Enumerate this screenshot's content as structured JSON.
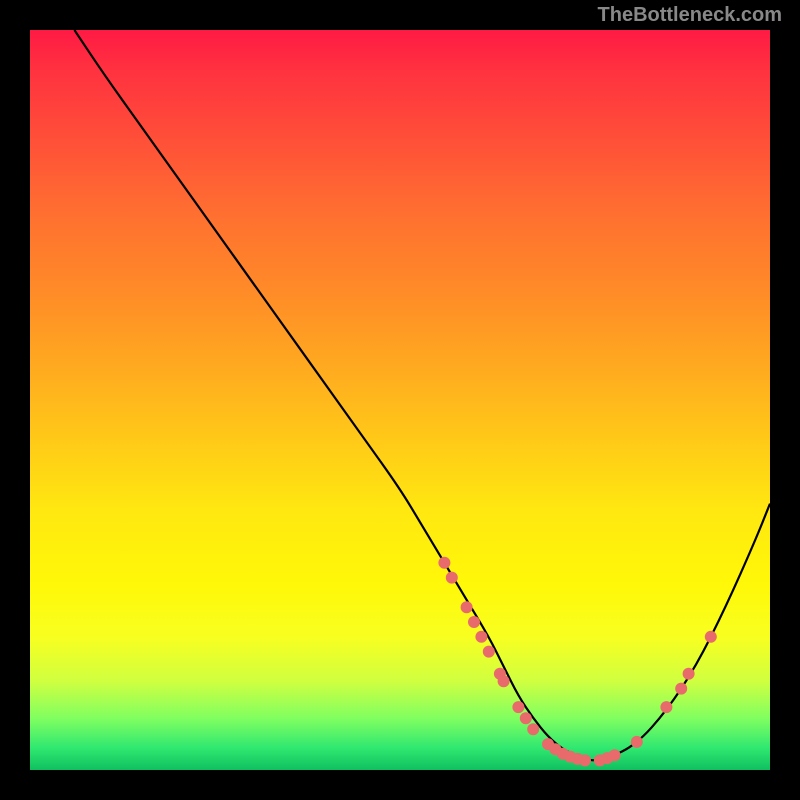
{
  "watermark": "TheBottleneck.com",
  "chart_data": {
    "type": "line",
    "title": "",
    "xlabel": "",
    "ylabel": "",
    "xlim": [
      0,
      100
    ],
    "ylim": [
      0,
      100
    ],
    "series": [
      {
        "name": "curve",
        "x": [
          6,
          10,
          15,
          20,
          25,
          30,
          35,
          40,
          45,
          50,
          53,
          56,
          59,
          62,
          64,
          66,
          68,
          70,
          72,
          74,
          76,
          78,
          82,
          86,
          90,
          94,
          98,
          100
        ],
        "y": [
          100,
          94,
          87,
          80,
          73,
          66,
          59,
          52,
          45,
          38,
          33,
          28,
          23,
          18,
          14,
          10,
          7,
          4.5,
          2.8,
          1.8,
          1.2,
          1.5,
          3.5,
          8,
          14,
          22,
          31,
          36
        ]
      }
    ],
    "markers": [
      {
        "x": 56,
        "y": 28
      },
      {
        "x": 57,
        "y": 26
      },
      {
        "x": 59,
        "y": 22
      },
      {
        "x": 60,
        "y": 20
      },
      {
        "x": 61,
        "y": 18
      },
      {
        "x": 62,
        "y": 16
      },
      {
        "x": 63.5,
        "y": 13
      },
      {
        "x": 64,
        "y": 12
      },
      {
        "x": 66,
        "y": 8.5
      },
      {
        "x": 67,
        "y": 7
      },
      {
        "x": 68,
        "y": 5.5
      },
      {
        "x": 70,
        "y": 3.5
      },
      {
        "x": 71,
        "y": 2.8
      },
      {
        "x": 72,
        "y": 2.2
      },
      {
        "x": 73,
        "y": 1.8
      },
      {
        "x": 74,
        "y": 1.5
      },
      {
        "x": 75,
        "y": 1.3
      },
      {
        "x": 77,
        "y": 1.3
      },
      {
        "x": 78,
        "y": 1.6
      },
      {
        "x": 79,
        "y": 2
      },
      {
        "x": 82,
        "y": 3.8
      },
      {
        "x": 86,
        "y": 8.5
      },
      {
        "x": 88,
        "y": 11
      },
      {
        "x": 89,
        "y": 13
      },
      {
        "x": 92,
        "y": 18
      }
    ],
    "gradient_stops": [
      {
        "pos": 0,
        "color": "#ff1a44"
      },
      {
        "pos": 50,
        "color": "#ffc818"
      },
      {
        "pos": 100,
        "color": "#10c060"
      }
    ]
  }
}
